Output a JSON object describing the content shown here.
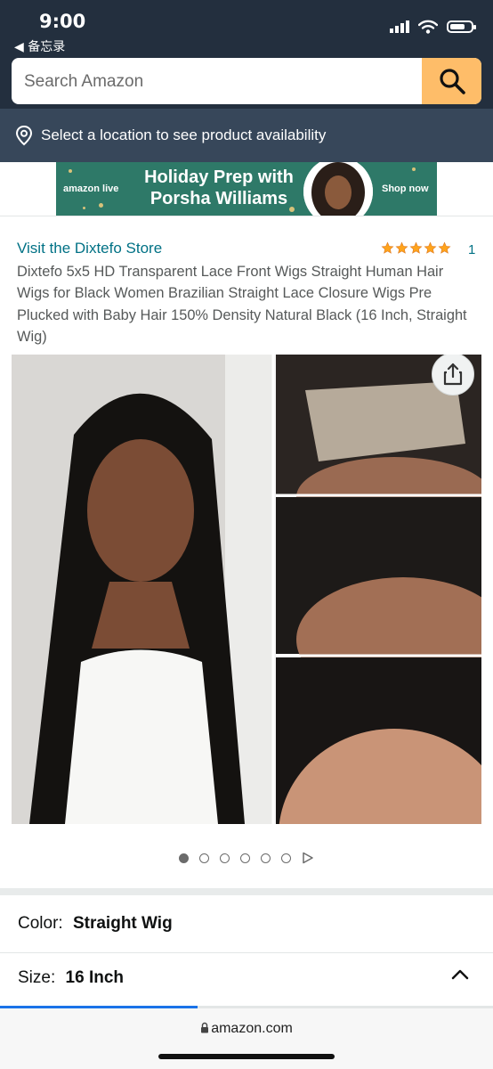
{
  "status": {
    "time": "9:00",
    "back_label": "◀ 备忘录"
  },
  "search": {
    "placeholder": "Search Amazon"
  },
  "location": {
    "text": "Select a location to see product availability"
  },
  "ad": {
    "brand": "amazon live",
    "headline_line1": "Holiday Prep with",
    "headline_line2": "Porsha Williams",
    "cta": "Shop now",
    "bg_color": "#2e7968"
  },
  "product": {
    "store_link": "Visit the Dixtefo Store",
    "rating_count": "1",
    "rating_stars": 5,
    "title": "Dixtefo 5x5 HD Transparent Lace Front Wigs Straight Human Hair Wigs for Black Women Brazilian Straight Lace Closure Wigs Pre Plucked with Baby Hair 150% Density Natural Black (16 Inch, Straight Wig)"
  },
  "gallery": {
    "image_count": 6,
    "active_index": 0
  },
  "options": {
    "color_label": "Color:",
    "color_value": "Straight Wig",
    "size_label": "Size:",
    "size_value": "16 Inch"
  },
  "browser": {
    "url": "amazon.com",
    "load_progress": 0.4
  },
  "colors": {
    "header_bg": "#232f3e",
    "location_bg": "#37475a",
    "search_button": "#febd69",
    "link": "#007185",
    "star": "#ffa41c"
  }
}
